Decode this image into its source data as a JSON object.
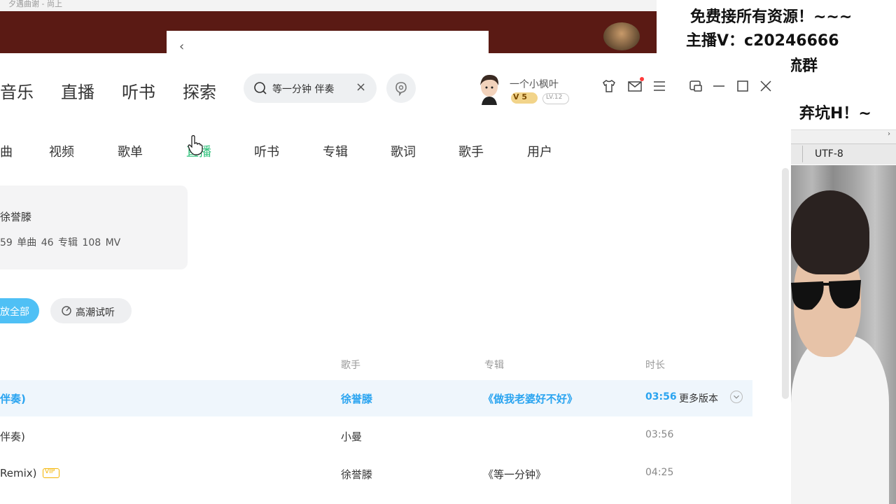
{
  "background_window": {
    "title": "夕遇曲谢 - 尚上",
    "back_glyph": "‹"
  },
  "overlay": {
    "line1": "免费接所有资源！~~~",
    "line2": "主播V：c20246666",
    "line3": "流群",
    "line4": "弃坑H！~"
  },
  "editor": {
    "encoding": "UTF-8",
    "arrow": "›"
  },
  "header": {
    "nav_tabs": [
      "音乐",
      "直播",
      "听书",
      "探索"
    ],
    "search": {
      "value": "等一分钟 伴奏",
      "clear_glyph": "×"
    },
    "user": {
      "name": "一个小枫叶",
      "vip_level": "V 5",
      "lv": "LV.12"
    }
  },
  "sub_tabs": [
    "曲",
    "视频",
    "歌单",
    "直播",
    "听书",
    "专辑",
    "歌词",
    "歌手",
    "用户"
  ],
  "artist_card": {
    "name": "徐誉滕",
    "stats": "59 单曲   46 专辑   108 MV"
  },
  "actions": {
    "play_all": "放全部",
    "climax": "高潮试听"
  },
  "table": {
    "headers": {
      "singer": "歌手",
      "album": "专辑",
      "duration": "时长"
    },
    "rows": [
      {
        "title": "伴奏)",
        "singer": "徐誉滕",
        "album": "《做我老婆好不好》",
        "duration": "03:56",
        "more": "更多版本"
      },
      {
        "title": "伴奏)",
        "singer": "小曼",
        "album": "",
        "duration": "03:56"
      },
      {
        "title": "Remix)",
        "singer": "徐誉滕",
        "album": "《等一分钟》",
        "duration": "04:25",
        "tag": "VIP"
      }
    ]
  },
  "colors": {
    "accent_blue": "#2aa4f0",
    "active_green": "#31c27c",
    "play_button": "#4fc0f5"
  }
}
